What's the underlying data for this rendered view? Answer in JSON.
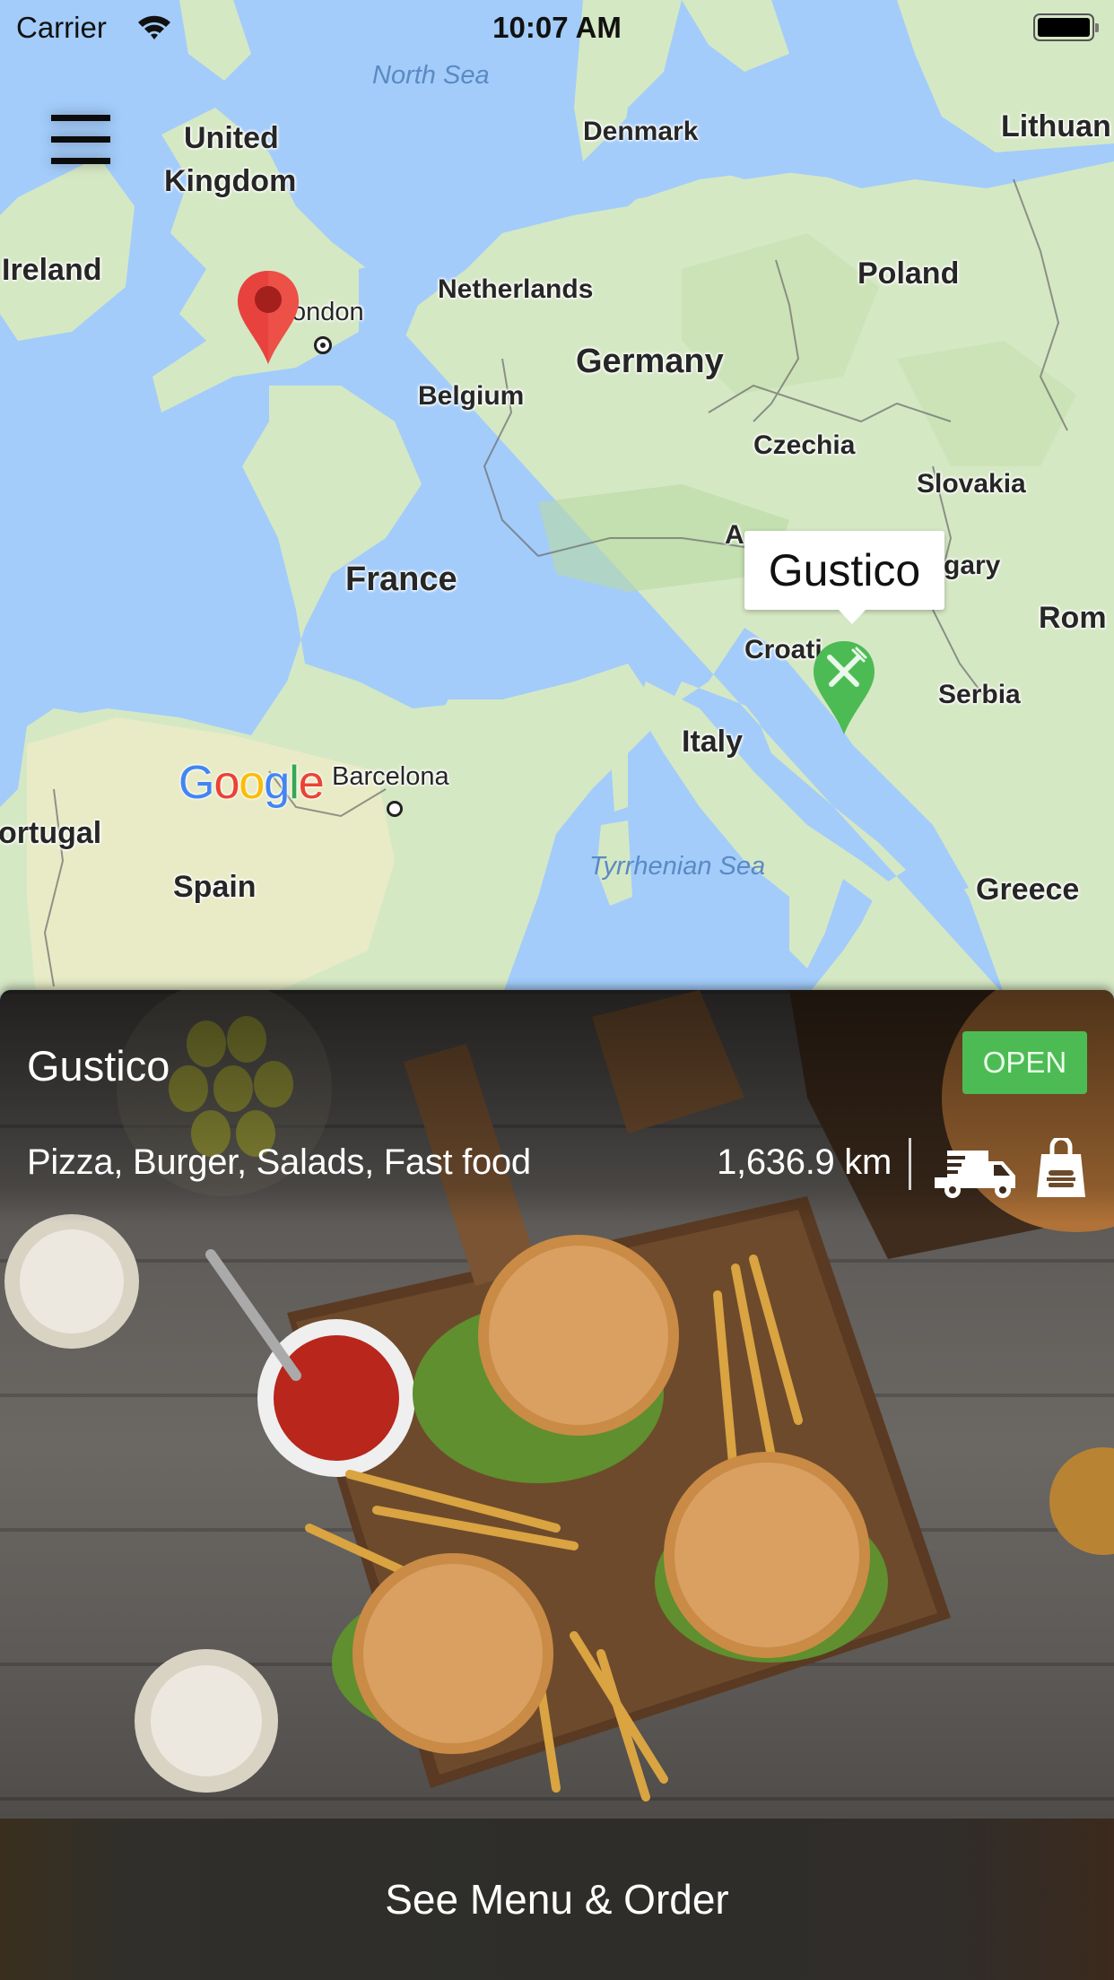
{
  "status_bar": {
    "carrier": "Carrier",
    "time": "10:07 AM",
    "wifi_icon": "wifi-icon",
    "battery_icon": "battery-full-icon"
  },
  "map": {
    "menu_icon": "hamburger-menu-icon",
    "provider_logo": "Google",
    "labels": {
      "north_sea": "North Sea",
      "denmark": "Denmark",
      "lithuania": "Lithuan",
      "united_kingdom_1": "United",
      "united_kingdom_2": "Kingdom",
      "ireland": "Ireland",
      "london": "ondon",
      "netherlands": "Netherlands",
      "poland": "Poland",
      "germany": "Germany",
      "belgium": "Belgium",
      "czechia": "Czechia",
      "slovakia": "Slovakia",
      "austria": "A",
      "hungary": "gary",
      "france": "France",
      "croatia": "Croati",
      "romania": "Rom",
      "serbia": "Serbia",
      "italy": "Italy",
      "barcelona": "Barcelona",
      "portugal": "ortugal",
      "spain": "Spain",
      "tyrrhenian_sea": "Tyrrhenian Sea",
      "greece": "Greece"
    },
    "user_marker_icon": "location-pin-icon",
    "restaurant_marker_icon": "restaurant-pin-icon",
    "callout_title": "Gustico",
    "colors": {
      "water": "#a3ccfa",
      "land": "#d5e8c4",
      "user_pin": "#e8423f",
      "restaurant_pin": "#4dbb54"
    }
  },
  "restaurant": {
    "name": "Gustico",
    "status": "OPEN",
    "cuisines": "Pizza, Burger, Salads, Fast food",
    "distance": "1,636.9 km",
    "delivery_icon": "delivery-truck-icon",
    "takeaway_icon": "takeaway-bag-icon",
    "status_color": "#4dbb54"
  },
  "actions": {
    "order_button": "See Menu & Order"
  }
}
